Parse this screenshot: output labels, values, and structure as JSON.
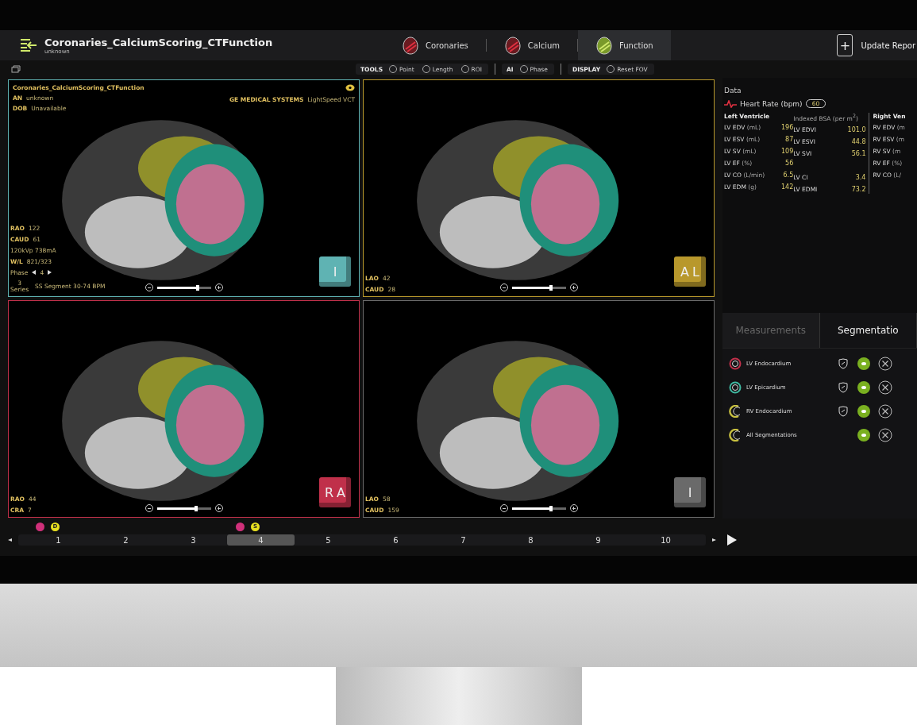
{
  "header": {
    "title": "Coronaries_CalciumScoring_CTFunction",
    "subtitle": "unknown",
    "update_icon": "+",
    "update_button": "Update Repor"
  },
  "tabs": [
    {
      "label": "Coronaries",
      "selected": false
    },
    {
      "label": "Calcium",
      "selected": false
    },
    {
      "label": "Function",
      "selected": true
    }
  ],
  "toolbar": [
    {
      "group": "TOOLS",
      "tools": [
        "Point",
        "Length",
        "ROI"
      ]
    },
    {
      "group": "AI",
      "tools": [
        "Phase"
      ]
    },
    {
      "group": "DISPLAY",
      "tools": [
        "Reset FOV"
      ]
    }
  ],
  "viewports": [
    {
      "color": "#5fb3b3",
      "title": "Coronaries_CalciumScoring_CTFunction",
      "info": [
        {
          "key": "AN",
          "value": "unknown"
        },
        {
          "key": "DOB",
          "value": "Unavailable"
        }
      ],
      "maker": "GE MEDICAL SYSTEMS",
      "model": "LightSpeed VCT",
      "angles": [
        {
          "key": "RAO",
          "value": "122"
        },
        {
          "key": "CAUD",
          "value": "61"
        }
      ],
      "params": [
        "120kVp 738mA"
      ],
      "wl": {
        "key": "W/L",
        "value": "821/323"
      },
      "phase": {
        "label": "Phase",
        "value": "4"
      },
      "series": {
        "count": "3",
        "label": "Series",
        "name": "SS Segment 30-74 BPM"
      },
      "cube": [
        "I"
      ],
      "level": 0.75
    },
    {
      "color": "#b8982c",
      "angles": [
        {
          "key": "LAO",
          "value": "42"
        },
        {
          "key": "CAUD",
          "value": "28"
        }
      ],
      "cube": [
        "A",
        "L"
      ],
      "level": 0.73
    },
    {
      "color": "#c0304a",
      "angles": [
        {
          "key": "RAO",
          "value": "44"
        },
        {
          "key": "CRA",
          "value": "7"
        }
      ],
      "cube": [
        "R",
        "A"
      ],
      "level": 0.73
    },
    {
      "color": "#6a6a6a",
      "angles": [
        {
          "key": "LAO",
          "value": "58"
        },
        {
          "key": "CAUD",
          "value": "159"
        }
      ],
      "cube": [
        "I"
      ],
      "level": 0.73
    }
  ],
  "data_panel": {
    "heading": "Data",
    "heart_rate_label": "Heart Rate (bpm)",
    "heart_rate": "60",
    "left_heading": "Left Ventricle",
    "indexed_heading": "Indexed BSA (per m$^{2}$)",
    "right_heading": "Right Ven",
    "rows": [
      {
        "label": "LV EDV",
        "unit": "(mL)",
        "value": "196",
        "indexed": {
          "label": "LV EDVI",
          "value": "101.0"
        }
      },
      {
        "label": "LV ESV",
        "unit": "(mL)",
        "value": "87",
        "indexed": {
          "label": "LV ESVI",
          "value": "44.8"
        }
      },
      {
        "label": "LV SV",
        "unit": "(mL)",
        "value": "109",
        "indexed": {
          "label": "LV SVI",
          "value": "56.1"
        }
      },
      {
        "label": "LV EF",
        "unit": "(%)",
        "value": "56"
      },
      {
        "label": "LV CO",
        "unit": "(L/min)",
        "value": "6.5",
        "indexed": {
          "label": "LV CI",
          "value": "3.4"
        }
      },
      {
        "label": "LV EDM",
        "unit": "(g)",
        "value": "142",
        "indexed": {
          "label": "LV EDMI",
          "value": "73.2"
        }
      }
    ],
    "right": [
      {
        "label": "RV EDV",
        "unit": "(m"
      },
      {
        "label": "RV ESV",
        "unit": "(m"
      },
      {
        "label": "RV SV",
        "unit": "(m"
      },
      {
        "label": "RV EF",
        "unit": "(%)"
      },
      {
        "label": "RV CO",
        "unit": "(L/"
      }
    ]
  },
  "panel_tabs": [
    {
      "label": "Measurements",
      "selected": false
    },
    {
      "label": "Segmentatio",
      "selected": true
    }
  ],
  "segmentations": [
    {
      "kind": "ring",
      "color": "#c0304a",
      "name": "LV Endocardium",
      "locked": true,
      "visible": true
    },
    {
      "kind": "ring",
      "color": "#3fb8a0",
      "name": "LV Epicardium",
      "locked": true,
      "visible": true
    },
    {
      "kind": "crescent",
      "color": "#c8c040",
      "name": "RV Endocardium",
      "locked": true,
      "visible": true
    },
    {
      "kind": "crescent",
      "color": "#c8c040",
      "name": "All Segmentations",
      "locked": false,
      "visible": true
    }
  ],
  "timeline": {
    "phases": [
      {
        "label": "1",
        "selected": false,
        "markers": [
          {
            "color": "#d0307a"
          },
          {
            "label": "D",
            "color": "#e8e020"
          }
        ]
      },
      {
        "label": "2",
        "selected": false
      },
      {
        "label": "3",
        "selected": false
      },
      {
        "label": "4",
        "selected": true,
        "markers": [
          {
            "color": "#d0307a"
          },
          {
            "label": "S",
            "color": "#e8e020"
          }
        ]
      },
      {
        "label": "5",
        "selected": false
      },
      {
        "label": "6",
        "selected": false
      },
      {
        "label": "7",
        "selected": false
      },
      {
        "label": "8",
        "selected": false
      },
      {
        "label": "9",
        "selected": false
      },
      {
        "label": "10",
        "selected": false
      }
    ]
  }
}
